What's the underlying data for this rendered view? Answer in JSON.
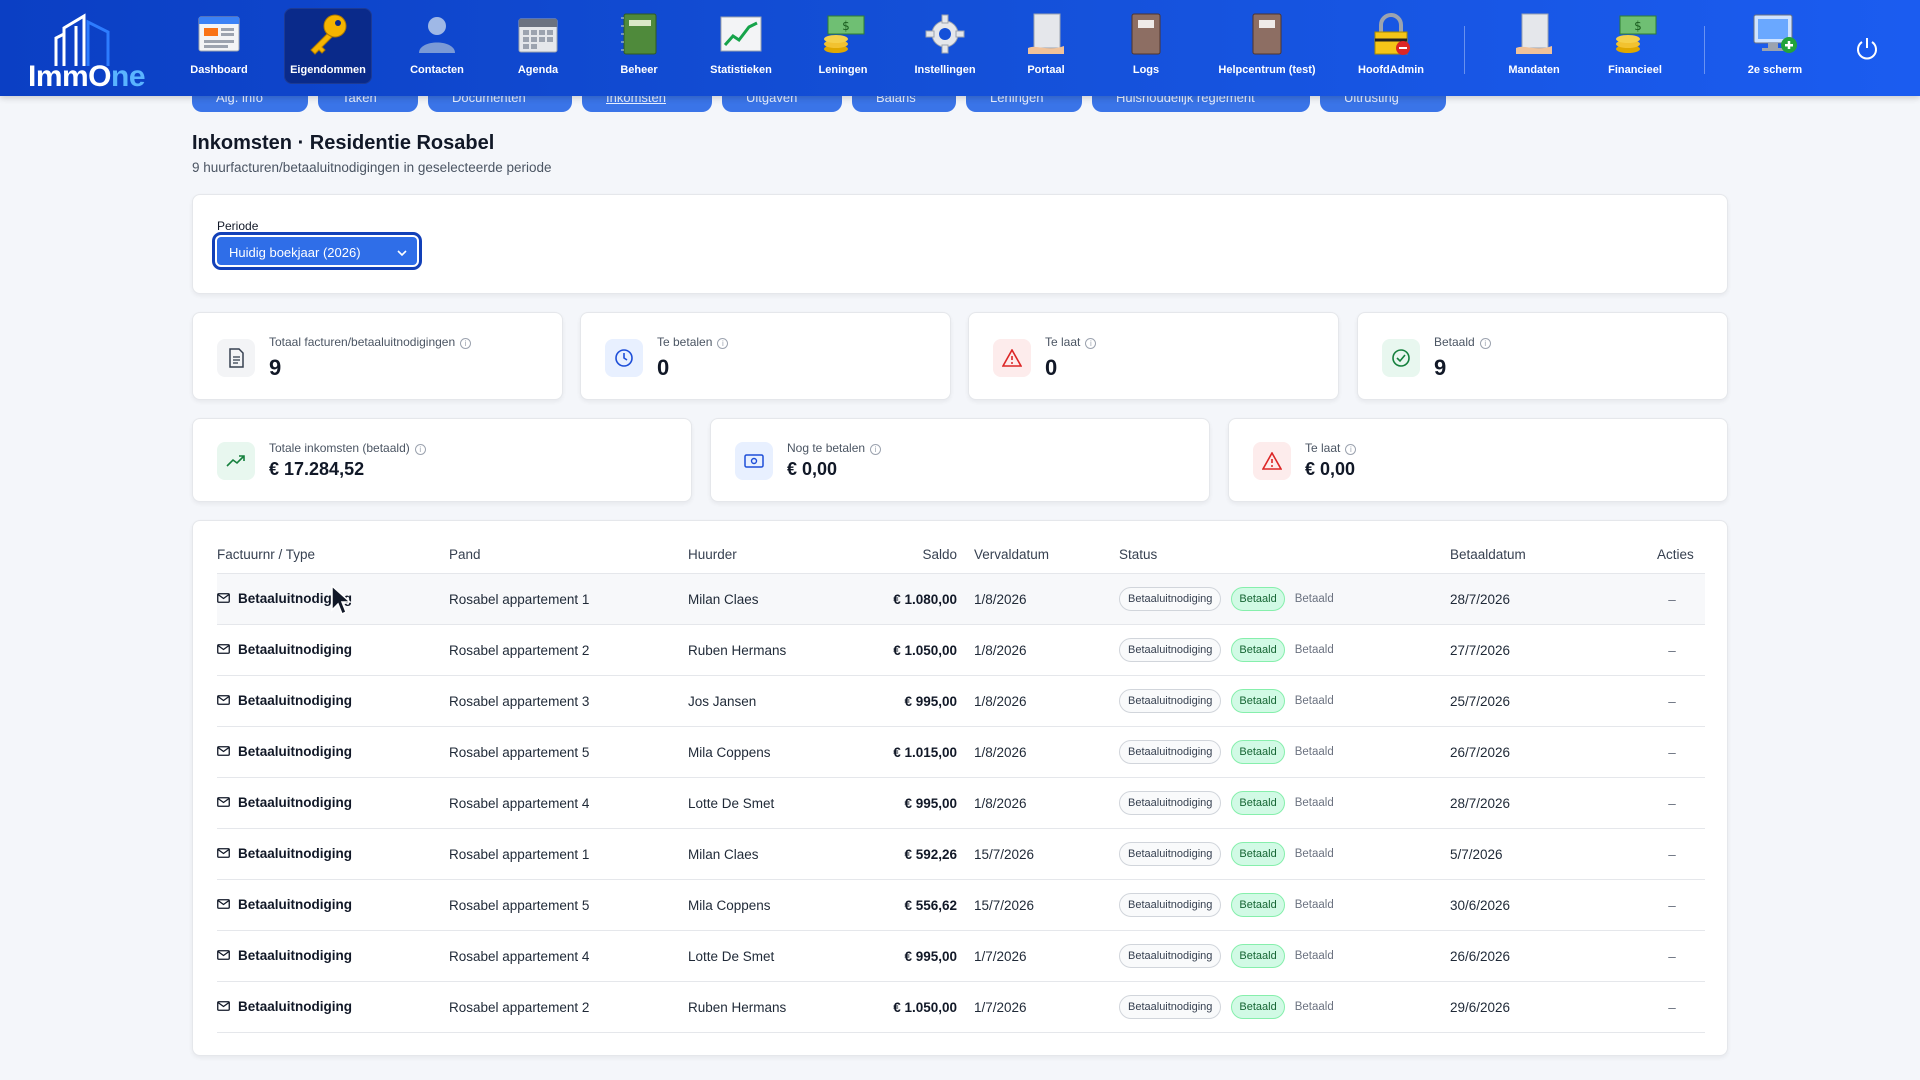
{
  "app": {
    "name_part1": "ImmO",
    "name_o": "n",
    "name_part2": "e"
  },
  "nav": [
    {
      "label": "Dashboard",
      "icon": "dashboard-icon"
    },
    {
      "label": "Eigendommen",
      "icon": "key-icon",
      "active": true
    },
    {
      "label": "Contacten",
      "icon": "person-icon"
    },
    {
      "label": "Agenda",
      "icon": "calendar-icon"
    },
    {
      "label": "Beheer",
      "icon": "notebook-icon"
    },
    {
      "label": "Statistieken",
      "icon": "chart-icon"
    },
    {
      "label": "Leningen",
      "icon": "money-icon"
    },
    {
      "label": "Instellingen",
      "icon": "gear-icon"
    },
    {
      "label": "Portaal",
      "icon": "portal-icon"
    },
    {
      "label": "Logs",
      "icon": "book-icon"
    },
    {
      "label": "Helpcentrum (test)",
      "icon": "help-book-icon"
    },
    {
      "label": "HoofdAdmin",
      "icon": "lock-icon"
    },
    {
      "label": "Mandaten",
      "icon": "mandate-icon"
    },
    {
      "label": "Financieel",
      "icon": "finance-icon"
    },
    {
      "label": "2e scherm",
      "icon": "monitor-plus-icon"
    }
  ],
  "subtabs": [
    "Alg. info",
    "Taken",
    "Documenten",
    "Inkomsten",
    "Uitgaven",
    "Balans",
    "Leningen",
    "Huishoudelijk reglement",
    "Uitrusting"
  ],
  "page": {
    "title": "Inkomsten · Residentie Rosabel",
    "subtitle": "9 huurfacturen/betaaluitnodigingen in geselecteerde periode"
  },
  "filter": {
    "label": "Periode",
    "selected": "Huidig boekjaar (2026)"
  },
  "stats_row1": [
    {
      "label": "Totaal facturen/betaaluitnodigingen",
      "value": "9",
      "icon": "document-icon"
    },
    {
      "label": "Te betalen",
      "value": "0",
      "icon": "clock-icon"
    },
    {
      "label": "Te laat",
      "value": "0",
      "icon": "warning-icon"
    },
    {
      "label": "Betaald",
      "value": "9",
      "icon": "check-circle-icon"
    }
  ],
  "stats_row2": [
    {
      "label": "Totale inkomsten (betaald)",
      "value": "€ 17.284,52",
      "icon": "trending-up-icon"
    },
    {
      "label": "Nog te betalen",
      "value": "€ 0,00",
      "icon": "cash-icon"
    },
    {
      "label": "Te laat",
      "value": "€ 0,00",
      "icon": "warning-icon"
    }
  ],
  "table": {
    "headers": {
      "factuur": "Factuurnr / Type",
      "pand": "Pand",
      "huurder": "Huurder",
      "saldo": "Saldo",
      "vervaldatum": "Vervaldatum",
      "status": "Status",
      "betaaldatum": "Betaaldatum",
      "acties": "Acties"
    },
    "rows": [
      {
        "type": "Betaaluitnodiging",
        "pand": "Rosabel appartement 1",
        "huurder": "Milan Claes",
        "saldo": "€ 1.080,00",
        "verval": "1/8/2026",
        "pill1": "Betaaluitnodiging",
        "pill2": "Betaald",
        "status": "Betaald",
        "betaald": "28/7/2026",
        "acties": "–"
      },
      {
        "type": "Betaaluitnodiging",
        "pand": "Rosabel appartement 2",
        "huurder": "Ruben Hermans",
        "saldo": "€ 1.050,00",
        "verval": "1/8/2026",
        "pill1": "Betaaluitnodiging",
        "pill2": "Betaald",
        "status": "Betaald",
        "betaald": "27/7/2026",
        "acties": "–"
      },
      {
        "type": "Betaaluitnodiging",
        "pand": "Rosabel appartement 3",
        "huurder": "Jos Jansen",
        "saldo": "€ 995,00",
        "verval": "1/8/2026",
        "pill1": "Betaaluitnodiging",
        "pill2": "Betaald",
        "status": "Betaald",
        "betaald": "25/7/2026",
        "acties": "–"
      },
      {
        "type": "Betaaluitnodiging",
        "pand": "Rosabel appartement 5",
        "huurder": "Mila Coppens",
        "saldo": "€ 1.015,00",
        "verval": "1/8/2026",
        "pill1": "Betaaluitnodiging",
        "pill2": "Betaald",
        "status": "Betaald",
        "betaald": "26/7/2026",
        "acties": "–"
      },
      {
        "type": "Betaaluitnodiging",
        "pand": "Rosabel appartement 4",
        "huurder": "Lotte De Smet",
        "saldo": "€ 995,00",
        "verval": "1/8/2026",
        "pill1": "Betaaluitnodiging",
        "pill2": "Betaald",
        "status": "Betaald",
        "betaald": "28/7/2026",
        "acties": "–"
      },
      {
        "type": "Betaaluitnodiging",
        "pand": "Rosabel appartement 1",
        "huurder": "Milan Claes",
        "saldo": "€ 592,26",
        "verval": "15/7/2026",
        "pill1": "Betaaluitnodiging",
        "pill2": "Betaald",
        "status": "Betaald",
        "betaald": "5/7/2026",
        "acties": "–"
      },
      {
        "type": "Betaaluitnodiging",
        "pand": "Rosabel appartement 5",
        "huurder": "Mila Coppens",
        "saldo": "€ 556,62",
        "verval": "15/7/2026",
        "pill1": "Betaaluitnodiging",
        "pill2": "Betaald",
        "status": "Betaald",
        "betaald": "30/6/2026",
        "acties": "–"
      },
      {
        "type": "Betaaluitnodiging",
        "pand": "Rosabel appartement 4",
        "huurder": "Lotte De Smet",
        "saldo": "€ 995,00",
        "verval": "1/7/2026",
        "pill1": "Betaaluitnodiging",
        "pill2": "Betaald",
        "status": "Betaald",
        "betaald": "26/6/2026",
        "acties": "–"
      },
      {
        "type": "Betaaluitnodiging",
        "pand": "Rosabel appartement 2",
        "huurder": "Ruben Hermans",
        "saldo": "€ 1.050,00",
        "verval": "1/7/2026",
        "pill1": "Betaaluitnodiging",
        "pill2": "Betaald",
        "status": "Betaald",
        "betaald": "29/6/2026",
        "acties": "–"
      }
    ]
  },
  "colors": {
    "nav_gradient_start": "#0b3fc4",
    "nav_gradient_end": "#1b5cf0",
    "select_bg": "#2f6ee8",
    "paid_pill_bg": "#d1fae5",
    "paid_pill_text": "#166534"
  }
}
